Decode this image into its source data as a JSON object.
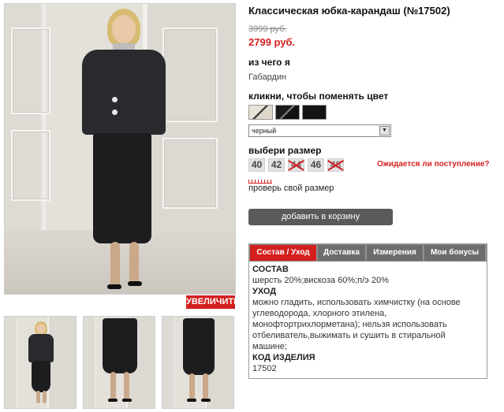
{
  "product": {
    "title": "Классическая юбка-карандаш (№17502)",
    "old_price": "3999 руб.",
    "new_price": "2799 руб."
  },
  "material": {
    "label": "из чего я",
    "value": "Габардин"
  },
  "color": {
    "label": "кликни, чтобы поменять цвет",
    "selected": "черный",
    "swatches": [
      "beige-black",
      "black-grey",
      "black"
    ]
  },
  "size": {
    "label": "выбери размер",
    "options": [
      {
        "value": "40",
        "available": true
      },
      {
        "value": "42",
        "available": true
      },
      {
        "value": "44",
        "available": false
      },
      {
        "value": "46",
        "available": true
      },
      {
        "value": "48",
        "available": false
      }
    ],
    "notify_link": "Ожидается ли поступление?",
    "check_link": "проверь свой размер"
  },
  "zoom_label": "УВЕЛИЧИТЬ",
  "cart_button": "добавить в корзину",
  "tabs": [
    {
      "label": "Состав / Уход",
      "active": true
    },
    {
      "label": "Доставка",
      "active": false
    },
    {
      "label": "Измерения",
      "active": false
    },
    {
      "label": "Мои бонусы",
      "active": false
    }
  ],
  "details": {
    "composition_heading": "СОСТАВ",
    "composition": "шерсть 20%;вискоза 60%;п/э 20%",
    "care_heading": "УХОД",
    "care": "можно гладить, использовать химчистку (на основе углеводорода, хлорного этилена, монофтортрихлорметана); нельзя использовать отбеливатель,выжимать и сушить в стиральной машине;",
    "code_heading": "КОД ИЗДЕЛИЯ",
    "code": "17502"
  },
  "colors": {
    "accent": "#d41f1f",
    "tab_inactive": "#6d6d6d",
    "button": "#5a5a5a"
  }
}
